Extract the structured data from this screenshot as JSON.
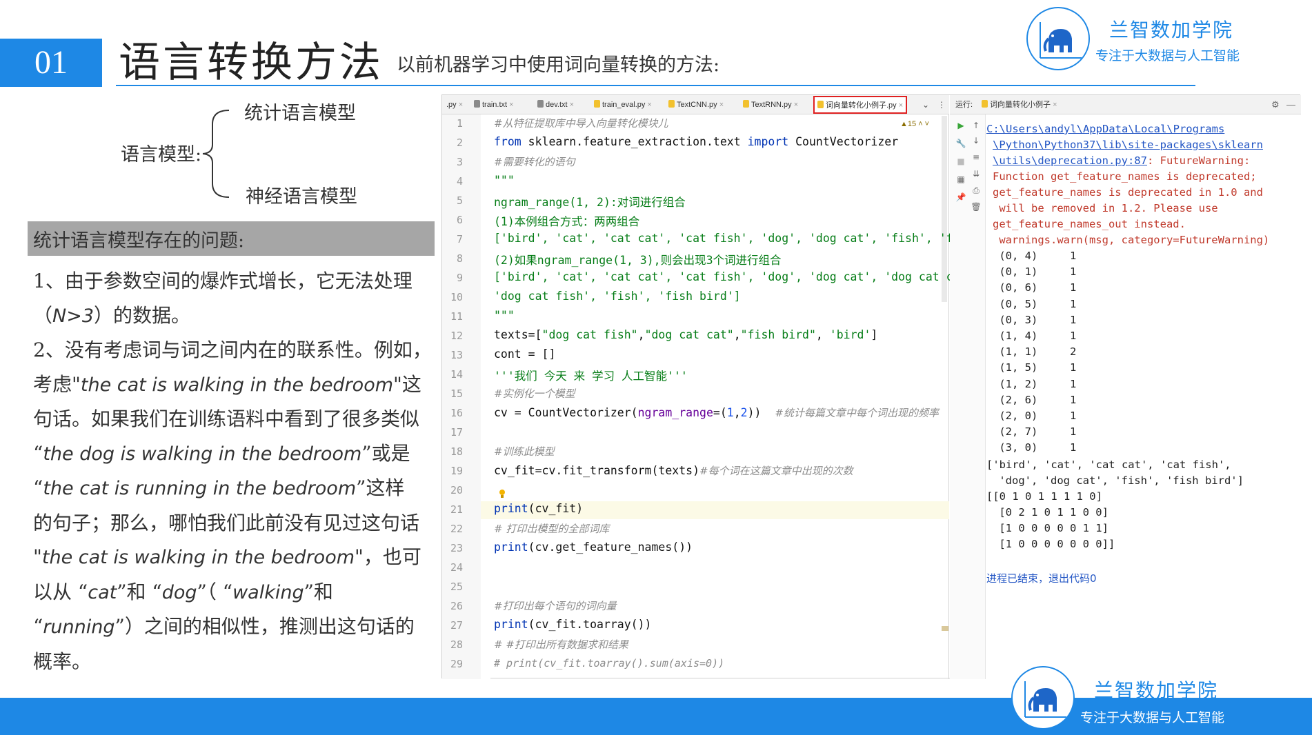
{
  "slide": {
    "number": "01",
    "title": "语言转换方法",
    "subtitle": "以前机器学习中使用词向量转换的方法:",
    "logo_name": "兰智数加学院",
    "logo_slogan": "专注于大数据与人工智能",
    "footer_logo_name": "兰智数加学院",
    "footer_logo_slogan": "专注于大数据与人工智能"
  },
  "content": {
    "lm_label": "语言模型:",
    "lm_item1": "统计语言模型",
    "lm_item2": "神经语言模型",
    "problem_heading": "统计语言模型存在的问题:",
    "p1a": "1、由于参数空间的爆炸式增长，它无法处理",
    "p1b_pre": "（",
    "p1b_hand": "N>3",
    "p1b_post": "）的数据。",
    "p2_l1": "2、没有考虑词与词之间内在的联系性。例如，",
    "p2_l2_pre": "考虑\"",
    "p2_l2_hand": "the cat is walking in the bedroom",
    "p2_l2_post": "\"这",
    "p2_l3": "句话。如果我们在训练语料中看到了很多类似",
    "p2_l4_pre": " “",
    "p2_l4_hand": "the dog is walking in the bedroom",
    "p2_l4_post": "”或是",
    "p2_l5_pre": " “",
    "p2_l5_hand": "the cat is running in the bedroom",
    "p2_l5_post": "”这样",
    "p2_l6": "的句子；那么，哪怕我们此前没有见过这句话",
    "p2_l7_pre": "\"",
    "p2_l7_hand": "the cat is walking in the bedroom",
    "p2_l7_post": "\"，也可",
    "p2_l8_pre": "以从 “",
    "p2_l8_hand1": "cat",
    "p2_l8_mid1": "”和 “",
    "p2_l8_hand2": "dog",
    "p2_l8_mid2": "”（ “",
    "p2_l8_hand3": "walking",
    "p2_l8_post": "”和",
    "p2_l9_pre": " “",
    "p2_l9_hand": "running",
    "p2_l9_post": "”）之间的相似性，推测出这句话的",
    "p2_l10": "概率。"
  },
  "ide": {
    "tabs": [
      {
        "label": ".py",
        "active": false
      },
      {
        "label": "train.txt",
        "active": false
      },
      {
        "label": "dev.txt",
        "active": false
      },
      {
        "label": "train_eval.py",
        "active": false
      },
      {
        "label": "TextCNN.py",
        "active": false
      },
      {
        "label": "TextRNN.py",
        "active": false
      },
      {
        "label": "词向量转化小例子.py",
        "active": true
      }
    ],
    "warning_count": "15",
    "run_label": "运行:",
    "run_tab": "词向量转化小例子",
    "code_lines": [
      "#从特征提取库中导入向量转化模块儿",
      "from sklearn.feature_extraction.text import CountVectorizer",
      "#需要转化的语句",
      "\"\"\"",
      "ngram_range(1, 2):对词进行组合",
      "(1)本例组合方式：两两组合",
      "['bird', 'cat', 'cat cat', 'cat fish', 'dog', 'dog cat', 'fish', 'fi",
      "(2)如果ngram_range(1, 3),则会出现3个词进行组合",
      "['bird', 'cat', 'cat cat', 'cat fish', 'dog', 'dog cat', 'dog cat ca",
      "'dog cat fish', 'fish', 'fish bird']",
      "\"\"\"",
      "texts=[\"dog cat fish\",\"dog cat cat\",\"fish bird\", 'bird']",
      "cont = []",
      "'''我们 今天 来 学习 人工智能'''",
      "#实例化一个模型",
      "cv = CountVectorizer(ngram_range=(1,2))",
      "#统计每篇文章中每个词出现的频率",
      "#训练此模型",
      "cv_fit=cv.fit_transform(texts)",
      "#每个词在这篇文章中出现的次数",
      "print(cv_fit)",
      "# 打印出模型的全部词库",
      "print(cv.get_feature_names())",
      "#打印出每个语句的词向量",
      "print(cv_fit.toarray())",
      "# #打印出所有数据求和结果",
      "# print(cv_fit.toarray().sum(axis=0))"
    ],
    "line_numbers": [
      "1",
      "2",
      "3",
      "4",
      "5",
      "6",
      "7",
      "8",
      "9",
      "10",
      "11",
      "12",
      "13",
      "14",
      "15",
      "16",
      "17",
      "18",
      "19",
      "20",
      "21",
      "22",
      "23",
      "24",
      "25",
      "26",
      "27",
      "28",
      "29"
    ],
    "output": {
      "link1": "C:\\Users\\andyl\\AppData\\Local\\Programs",
      "link2": "\\Python\\Python37\\lib\\site-packages\\sklearn",
      "link3": "\\utils\\deprecation.py:87",
      "warn_tail": ": FutureWarning:",
      "w1": "Function get_feature_names is deprecated;",
      "w2": "get_feature_names is deprecated in 1.0 and",
      "w3": " will be removed in 1.2. Please use",
      "w4": "get_feature_names_out instead.",
      "w5": " warnings.warn(msg, category=FutureWarning)",
      "sparse": [
        " (0, 4)\t1",
        " (0, 1)\t1",
        " (0, 6)\t1",
        " (0, 5)\t1",
        " (0, 3)\t1",
        " (1, 4)\t1",
        " (1, 1)\t2",
        " (1, 5)\t1",
        " (1, 2)\t1",
        " (2, 6)\t1",
        " (2, 0)\t1",
        " (2, 7)\t1",
        " (3, 0)\t1"
      ],
      "names1": "['bird', 'cat', 'cat cat', 'cat fish',",
      "names2": " 'dog', 'dog cat', 'fish', 'fish bird']",
      "arr1": "[[0 1 0 1 1 1 1 0]",
      "arr2": " [0 2 1 0 1 1 0 0]",
      "arr3": " [1 0 0 0 0 0 1 1]",
      "arr4": " [1 0 0 0 0 0 0 0]]",
      "status": "进程已结束，退出代码0"
    }
  },
  "colors": {
    "accent": "#1e88e5",
    "active_tab_border": "#e02020"
  }
}
